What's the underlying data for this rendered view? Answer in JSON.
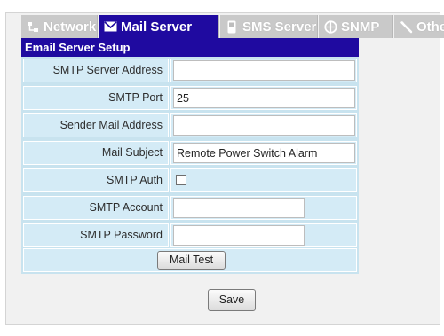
{
  "tabs": [
    {
      "label": "Network",
      "icon": "network-icon",
      "active": false
    },
    {
      "label": "Mail Server",
      "icon": "envelope-icon",
      "active": true
    },
    {
      "label": "SMS Server",
      "icon": "phone-icon",
      "active": false
    },
    {
      "label": "SNMP",
      "icon": "globe-icon",
      "active": false
    },
    {
      "label": "Other",
      "icon": "wrench-icon",
      "active": false
    }
  ],
  "form": {
    "title": "Email Server Setup",
    "rows": [
      {
        "label": "SMTP Server Address",
        "value": ""
      },
      {
        "label": "SMTP Port",
        "value": "25"
      },
      {
        "label": "Sender Mail Address",
        "value": ""
      },
      {
        "label": "Mail Subject",
        "value": "Remote Power Switch Alarm"
      },
      {
        "label": "SMTP Auth",
        "checked": false
      },
      {
        "label": "SMTP Account",
        "value": ""
      },
      {
        "label": "SMTP Password",
        "value": ""
      }
    ],
    "test_button": "Mail Test"
  },
  "save_button": "Save",
  "colors": {
    "accent": "#1f0aa0",
    "row_bg": "#d4ebf6",
    "tab_inactive": "#c9c9c9"
  }
}
